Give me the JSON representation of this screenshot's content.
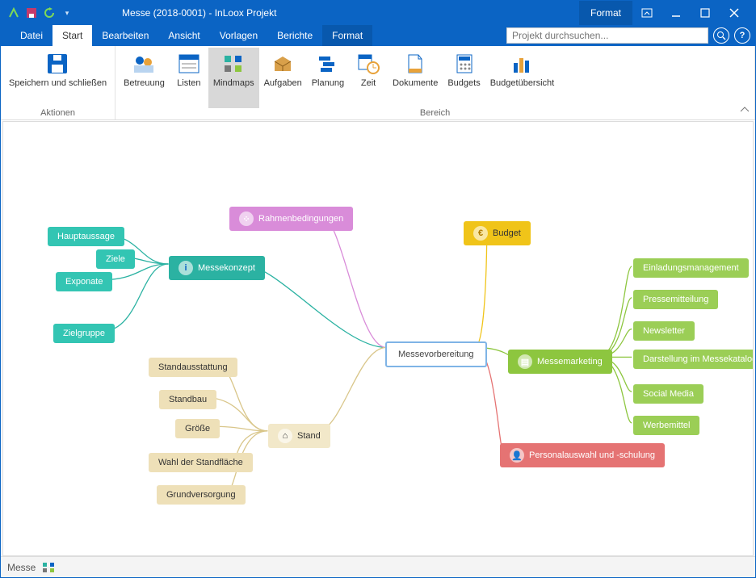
{
  "title": "Messe (2018-0001) - InLoox Projekt",
  "context_tab": "Format",
  "menu": {
    "items": [
      "Datei",
      "Start",
      "Bearbeiten",
      "Ansicht",
      "Vorlagen",
      "Berichte",
      "Format"
    ],
    "active": "Start"
  },
  "search": {
    "placeholder": "Projekt durchsuchen..."
  },
  "ribbon": {
    "groups": [
      {
        "label": "Aktionen",
        "buttons": [
          {
            "id": "save-close",
            "label": "Speichern und\nschließen"
          }
        ]
      },
      {
        "label": "Bereich",
        "buttons": [
          {
            "id": "betreuung",
            "label": "Betreuung"
          },
          {
            "id": "listen",
            "label": "Listen"
          },
          {
            "id": "mindmaps",
            "label": "Mindmaps",
            "selected": true
          },
          {
            "id": "aufgaben",
            "label": "Aufgaben"
          },
          {
            "id": "planung",
            "label": "Planung"
          },
          {
            "id": "zeit",
            "label": "Zeit"
          },
          {
            "id": "dokumente",
            "label": "Dokumente"
          },
          {
            "id": "budgets",
            "label": "Budgets"
          },
          {
            "id": "budgetuebersicht",
            "label": "Budgetübersicht"
          }
        ]
      }
    ]
  },
  "mindmap": {
    "central": "Messevorbereitung",
    "rahmen": "Rahmenbedingungen",
    "budget": "Budget",
    "messe_konzept": {
      "label": "Messekonzept",
      "children": [
        "Hauptaussage",
        "Ziele",
        "Exponate",
        "Zielgruppe"
      ]
    },
    "stand": {
      "label": "Stand",
      "children": [
        "Standausstattung",
        "Standbau",
        "Größe",
        "Wahl der Standfläche",
        "Grundversorgung"
      ]
    },
    "marketing": {
      "label": "Messemarketing",
      "children": [
        "Einladungsmanagement",
        "Pressemitteilung",
        "Newsletter",
        "Darstellung im Messekatalog",
        "Social Media",
        "Werbemittel"
      ]
    },
    "personal": "Personalauswahl und -schulung"
  },
  "statusbar": {
    "tab": "Messe"
  }
}
